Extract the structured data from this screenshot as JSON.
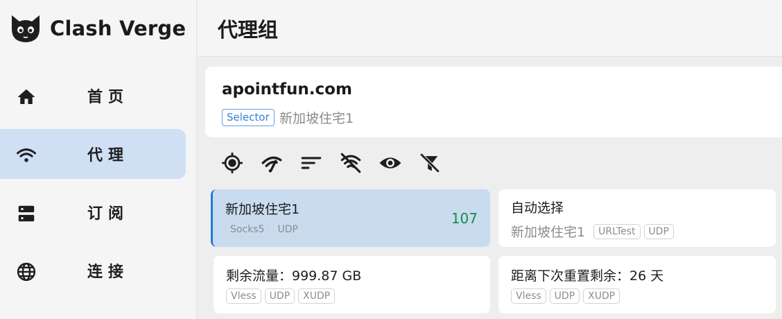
{
  "app": {
    "title": "Clash Verge"
  },
  "sidebar": {
    "items": [
      {
        "label": "首页",
        "icon": "home-icon",
        "active": false
      },
      {
        "label": "代理",
        "icon": "wifi-icon",
        "active": true
      },
      {
        "label": "订阅",
        "icon": "storage-icon",
        "active": false
      },
      {
        "label": "连接",
        "icon": "globe-icon",
        "active": false
      }
    ]
  },
  "header": {
    "title": "代理组"
  },
  "group": {
    "name": "apointfun.com",
    "type": "Selector",
    "now": "新加坡住宅1"
  },
  "toolbar": {
    "icons": [
      "locate-icon",
      "speed-test-icon",
      "sort-icon",
      "no-signal-filter-icon",
      "visibility-icon",
      "filter-off-icon"
    ]
  },
  "proxies": [
    {
      "name": "新加坡住宅1",
      "tags": [
        "Socks5",
        "UDP"
      ],
      "delay": "107",
      "selected": true
    },
    {
      "name": "自动选择",
      "sub": "新加坡住宅1",
      "tags": [
        "URLTest",
        "UDP"
      ],
      "selected": false
    },
    {
      "name": "剩余流量：999.87 GB",
      "tags": [
        "Vless",
        "UDP",
        "XUDP"
      ],
      "selected": false
    },
    {
      "name": "距离下次重置剩余：26 天",
      "tags": [
        "Vless",
        "UDP",
        "XUDP"
      ],
      "selected": false
    }
  ],
  "colors": {
    "accent": "#1e7be0",
    "active_nav_bg": "#cfe0f5",
    "selected_card_bg": "#c9dbef",
    "delay_good": "#1a8a4a"
  }
}
